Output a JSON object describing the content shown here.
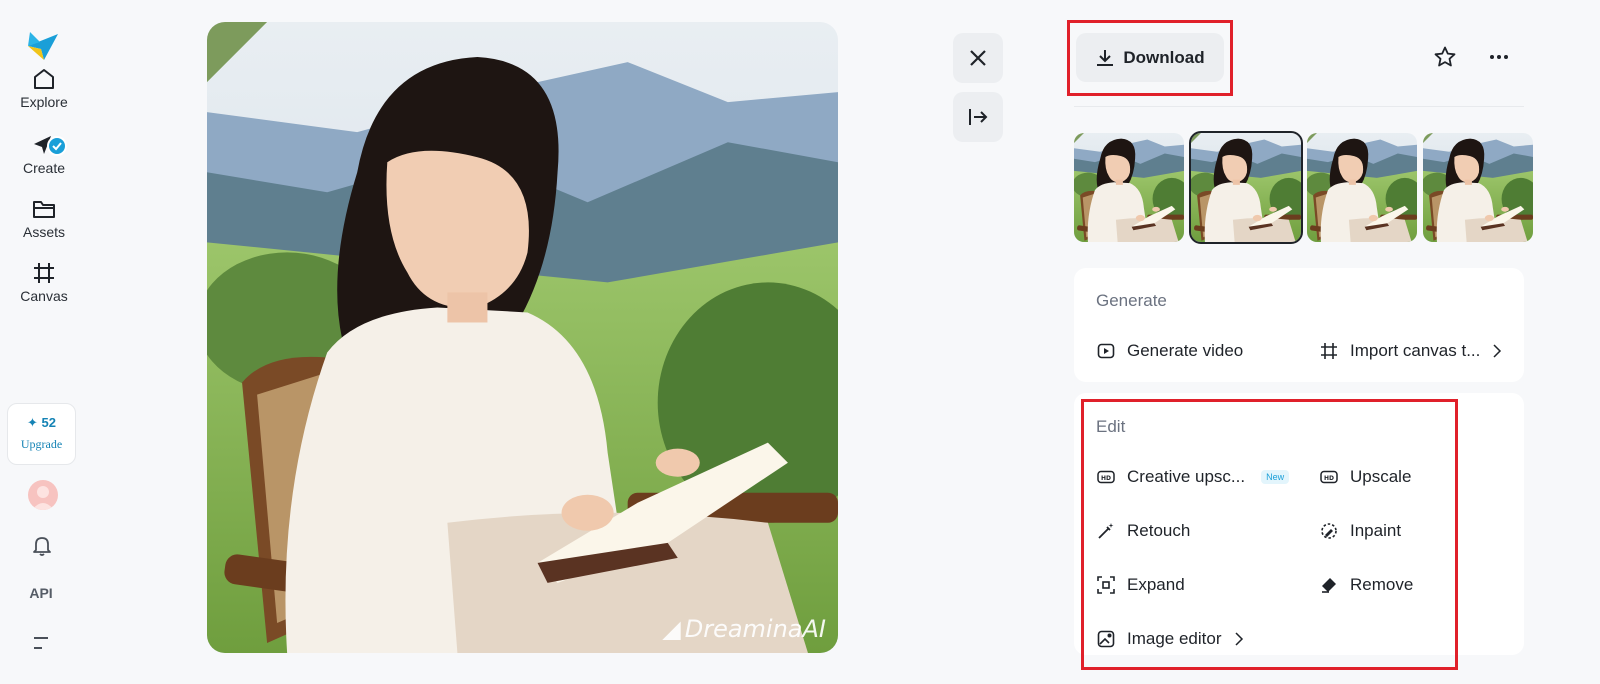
{
  "nav": {
    "items": [
      {
        "label": "Explore",
        "icon": "home-icon"
      },
      {
        "label": "Create",
        "icon": "create-icon"
      },
      {
        "label": "Assets",
        "icon": "folder-icon"
      },
      {
        "label": "Canvas",
        "icon": "canvas-icon"
      }
    ],
    "credits": "52",
    "upgrade_label": "Upgrade",
    "api_label": "API"
  },
  "image": {
    "watermark": "DreaminaAI"
  },
  "panel": {
    "download_label": "Download",
    "generate": {
      "title": "Generate",
      "items": [
        {
          "label": "Generate video",
          "icon": "play-icon"
        },
        {
          "label": "Import canvas t...",
          "icon": "canvas-icon"
        }
      ]
    },
    "edit": {
      "title": "Edit",
      "items": [
        {
          "label": "Creative upsc...",
          "icon": "hd-plus-icon",
          "badge": "New"
        },
        {
          "label": "Upscale",
          "icon": "hd-icon"
        },
        {
          "label": "Retouch",
          "icon": "magic-wand-icon"
        },
        {
          "label": "Inpaint",
          "icon": "inpaint-icon"
        },
        {
          "label": "Expand",
          "icon": "expand-icon"
        },
        {
          "label": "Remove",
          "icon": "eraser-icon"
        },
        {
          "label": "Image editor",
          "icon": "image-editor-icon"
        }
      ]
    }
  },
  "colors": {
    "accent": "#1a9fd8",
    "highlight": "#e0202a"
  }
}
